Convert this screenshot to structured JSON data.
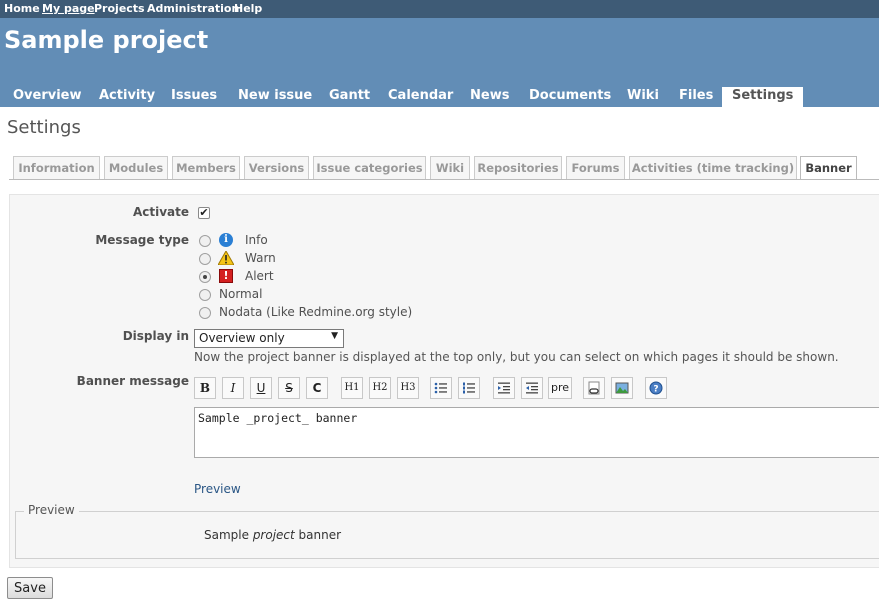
{
  "top_menu": {
    "home": "Home",
    "my_page": "My page",
    "projects": "Projects",
    "administration": "Administration",
    "help": "Help"
  },
  "project": {
    "title": "Sample project"
  },
  "main_menu": [
    "Overview",
    "Activity",
    "Issues",
    "New issue",
    "Gantt",
    "Calendar",
    "News",
    "Documents",
    "Wiki",
    "Files",
    "Settings"
  ],
  "page_title": "Settings",
  "tabs": [
    "Information",
    "Modules",
    "Members",
    "Versions",
    "Issue categories",
    "Wiki",
    "Repositories",
    "Forums",
    "Activities (time tracking)",
    "Banner"
  ],
  "selected_tab": "Banner",
  "form": {
    "activate_label": "Activate",
    "activate_checked": true,
    "message_type_label": "Message type",
    "message_types": [
      "Info",
      "Warn",
      "Alert",
      "Normal",
      "Nodata (Like Redmine.org style)"
    ],
    "selected_message_type": "Alert",
    "display_in_label": "Display in",
    "display_in_value": "Overview only",
    "display_in_hint": "Now the project banner is displayed at the top only, but you can select on which pages it should be shown.",
    "banner_message_label": "Banner message",
    "toolbar": {
      "bold": "B",
      "italic": "I",
      "underline": "U",
      "strike": "S",
      "code": "C",
      "h1": "H1",
      "h2": "H2",
      "h3": "H3",
      "pre": "pre"
    },
    "banner_message_value": "Sample _project_ banner",
    "preview_link": "Preview",
    "preview_legend": "Preview",
    "preview_prefix": "Sample ",
    "preview_emphasis": "project",
    "preview_suffix": " banner"
  },
  "save_label": "Save",
  "colors": {
    "top_menu_bg": "#3e5b76",
    "header_bg": "#628db6",
    "link": "#2a5685",
    "alert": "#d42020",
    "info": "#2a7fd4",
    "warn": "#f5c518"
  }
}
